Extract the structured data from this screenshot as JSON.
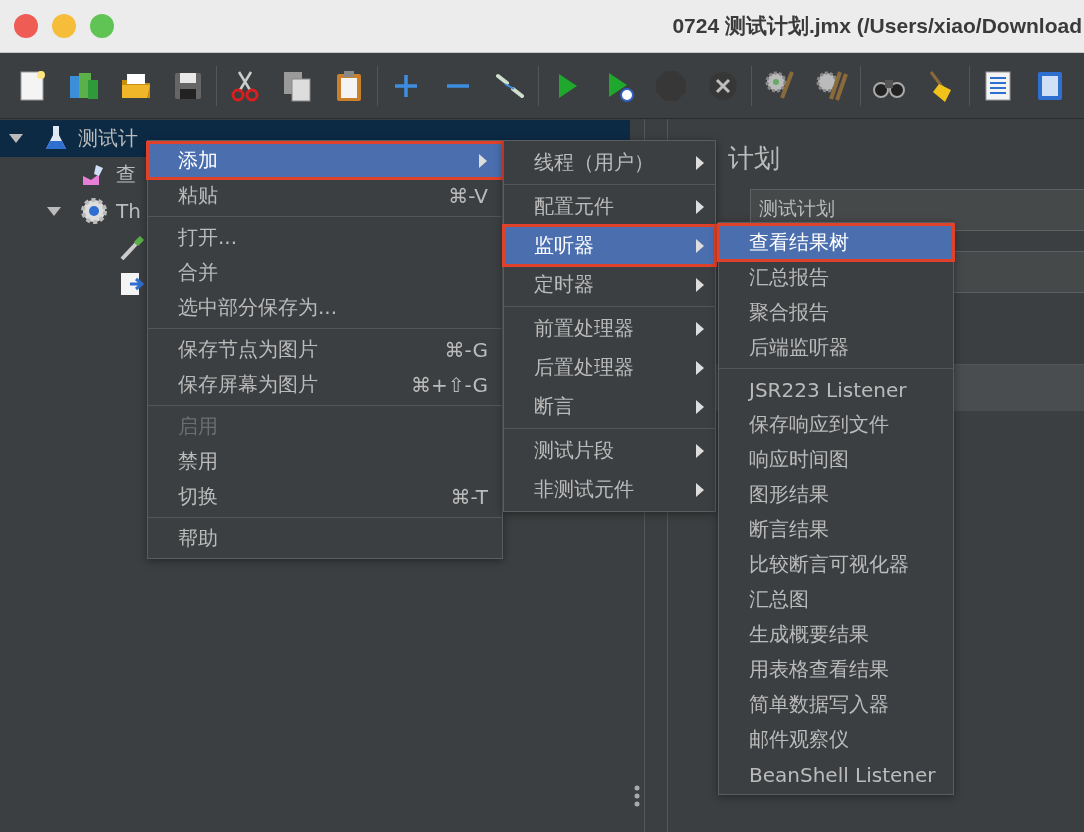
{
  "window": {
    "title": "0724 测试计划.jmx (/Users/xiao/Download"
  },
  "toolbar": [
    {
      "kind": "new",
      "disabled": false
    },
    {
      "kind": "templates",
      "disabled": false
    },
    {
      "kind": "open",
      "disabled": false
    },
    {
      "kind": "save",
      "disabled": false
    },
    {
      "kind": "separator"
    },
    {
      "kind": "cut",
      "disabled": false
    },
    {
      "kind": "copy",
      "disabled": false
    },
    {
      "kind": "paste",
      "disabled": false
    },
    {
      "kind": "separator"
    },
    {
      "kind": "expand",
      "disabled": false
    },
    {
      "kind": "collapse",
      "disabled": false
    },
    {
      "kind": "toggle",
      "disabled": false
    },
    {
      "kind": "separator"
    },
    {
      "kind": "start",
      "disabled": false
    },
    {
      "kind": "start_no_pause",
      "disabled": false
    },
    {
      "kind": "stop",
      "disabled": true
    },
    {
      "kind": "shutdown",
      "disabled": true
    },
    {
      "kind": "separator"
    },
    {
      "kind": "clear",
      "disabled": false
    },
    {
      "kind": "clear_all",
      "disabled": false
    },
    {
      "kind": "separator"
    },
    {
      "kind": "search",
      "disabled": false
    },
    {
      "kind": "reset_search",
      "disabled": false
    },
    {
      "kind": "separator"
    },
    {
      "kind": "function_helper",
      "disabled": false
    },
    {
      "kind": "help",
      "disabled": false
    }
  ],
  "tree": [
    {
      "kind": "plan",
      "label": "测试计",
      "selected": true,
      "expanded": true,
      "children": [
        {
          "kind": "listener",
          "label": "查",
          "selected": false
        },
        {
          "kind": "thread_group",
          "label": "Th",
          "selected": false,
          "expanded": true,
          "children": [
            {
              "kind": "sampler",
              "selected": false
            },
            {
              "kind": "script",
              "selected": false
            }
          ]
        }
      ]
    }
  ],
  "editor": {
    "heading": "计划",
    "name_field": "测试计划"
  },
  "context_menu": {
    "groups": [
      [
        {
          "label": "添加",
          "submenu": true,
          "selected": true,
          "disabled": false
        },
        {
          "label": "粘贴",
          "shortcut": "⌘-V",
          "selected": false,
          "disabled": false
        }
      ],
      [
        {
          "label": "打开...",
          "selected": false,
          "disabled": false
        },
        {
          "label": "合并",
          "selected": false,
          "disabled": false
        },
        {
          "label": "选中部分保存为...",
          "selected": false,
          "disabled": false
        }
      ],
      [
        {
          "label": "保存节点为图片",
          "shortcut": "⌘-G",
          "selected": false,
          "disabled": false
        },
        {
          "label": "保存屏幕为图片",
          "shortcut": "⌘+⇧-G",
          "selected": false,
          "disabled": false
        }
      ],
      [
        {
          "label": "启用",
          "selected": false,
          "disabled": true
        },
        {
          "label": "禁用",
          "selected": false,
          "disabled": false
        },
        {
          "label": "切换",
          "shortcut": "⌘-T",
          "selected": false,
          "disabled": false
        }
      ],
      [
        {
          "label": "帮助",
          "selected": false,
          "disabled": false
        }
      ]
    ]
  },
  "add_submenu": {
    "groups": [
      [
        {
          "label": "线程（用户）",
          "submenu": true,
          "selected": false,
          "disabled": false
        }
      ],
      [
        {
          "label": "配置元件",
          "submenu": true,
          "selected": false,
          "disabled": false
        },
        {
          "label": "监听器",
          "submenu": true,
          "selected": true,
          "disabled": false
        },
        {
          "label": "定时器",
          "submenu": true,
          "selected": false,
          "disabled": false
        }
      ],
      [
        {
          "label": "前置处理器",
          "submenu": true,
          "selected": false,
          "disabled": false
        },
        {
          "label": "后置处理器",
          "submenu": true,
          "selected": false,
          "disabled": false
        },
        {
          "label": "断言",
          "submenu": true,
          "selected": false,
          "disabled": false
        }
      ],
      [
        {
          "label": "测试片段",
          "submenu": true,
          "selected": false,
          "disabled": false
        },
        {
          "label": "非测试元件",
          "submenu": true,
          "selected": false,
          "disabled": false
        }
      ]
    ]
  },
  "listener_submenu": {
    "groups": [
      [
        {
          "label": "查看结果树",
          "selected": true,
          "disabled": false
        },
        {
          "label": "汇总报告",
          "selected": false,
          "disabled": false
        },
        {
          "label": "聚合报告",
          "selected": false,
          "disabled": false
        },
        {
          "label": "后端监听器",
          "selected": false,
          "disabled": false
        }
      ],
      [
        {
          "label": "JSR223 Listener",
          "selected": false,
          "disabled": false
        },
        {
          "label": "保存响应到文件",
          "selected": false,
          "disabled": false
        },
        {
          "label": "响应时间图",
          "selected": false,
          "disabled": false
        },
        {
          "label": "图形结果",
          "selected": false,
          "disabled": false
        },
        {
          "label": "断言结果",
          "selected": false,
          "disabled": false
        },
        {
          "label": "比较断言可视化器",
          "selected": false,
          "disabled": false
        },
        {
          "label": "汇总图",
          "selected": false,
          "disabled": false
        },
        {
          "label": "生成概要结果",
          "selected": false,
          "disabled": false
        },
        {
          "label": "用表格查看结果",
          "selected": false,
          "disabled": false
        },
        {
          "label": "简单数据写入器",
          "selected": false,
          "disabled": false
        },
        {
          "label": "邮件观察仪",
          "selected": false,
          "disabled": false
        },
        {
          "label": "BeanShell Listener",
          "selected": false,
          "disabled": false
        }
      ]
    ]
  }
}
